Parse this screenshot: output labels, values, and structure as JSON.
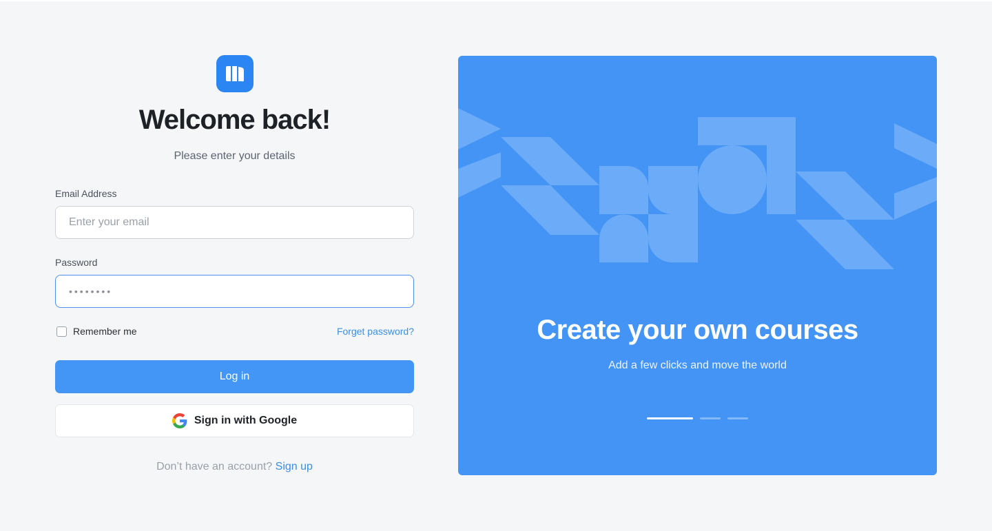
{
  "login": {
    "title": "Welcome back!",
    "subtitle": "Please enter your details",
    "email_label": "Email Address",
    "email_placeholder": "Enter your email",
    "password_label": "Password",
    "password_value": "••••••••",
    "remember_label": "Remember me",
    "forgot_label": "Forget password?",
    "login_button": "Log in",
    "google_button": "Sign in with Google",
    "signup_prompt": "Don’t have an account?",
    "signup_link": "Sign up"
  },
  "hero": {
    "title": "Create your own courses",
    "subtitle": "Add a few clicks and move the world",
    "carousel_total": 3,
    "carousel_active": 1
  },
  "colors": {
    "primary": "#4396f5",
    "link": "#3a8ee6",
    "background": "#f5f6f8"
  },
  "icons": [
    "app-logo-icon",
    "google-icon",
    "checkbox-icon"
  ]
}
